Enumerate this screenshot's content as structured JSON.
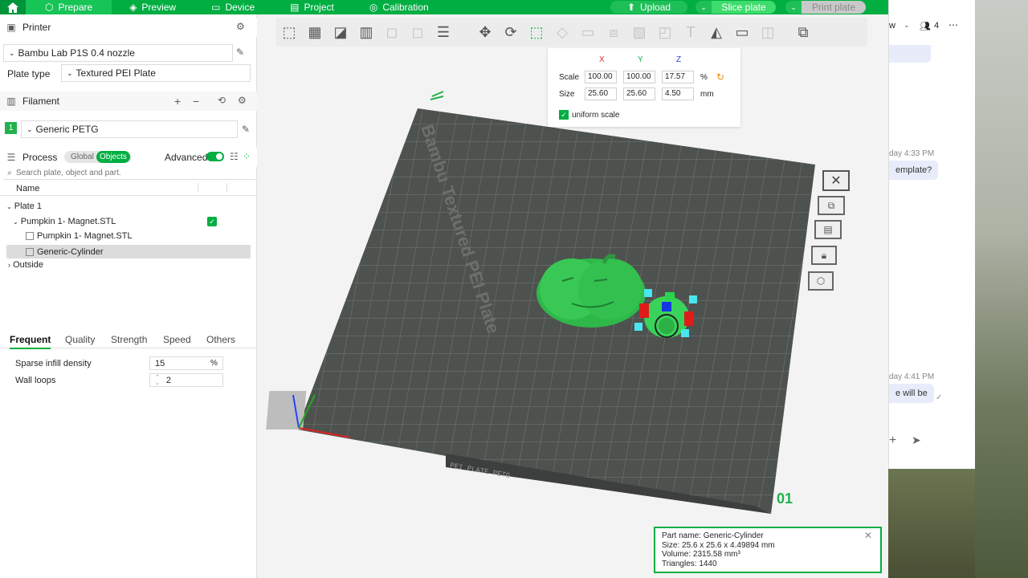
{
  "topbar": {
    "tabs": [
      {
        "label": "Prepare",
        "icon": "cube-icon"
      },
      {
        "label": "Preview",
        "icon": "layers-icon"
      },
      {
        "label": "Device",
        "icon": "monitor-icon"
      },
      {
        "label": "Project",
        "icon": "document-icon"
      },
      {
        "label": "Calibration",
        "icon": "gauge-icon"
      }
    ],
    "upload_label": "Upload",
    "slice_label": "Slice plate",
    "print_label": "Print plate",
    "accent": "#00ae42"
  },
  "printer": {
    "section_title": "Printer",
    "printer_name": "Bambu Lab P1S 0.4 nozzle",
    "plate_type_label": "Plate type",
    "plate_type_value": "Textured PEI Plate"
  },
  "filament": {
    "section_title": "Filament",
    "slot_number": "1",
    "slot_name": "Generic PETG",
    "slot_color": "#22b14c"
  },
  "process": {
    "section_title": "Process",
    "toggle_global": "Global",
    "toggle_objects": "Objects",
    "advanced_label": "Advanced",
    "search_placeholder": "Search plate, object and part.",
    "column_name": "Name"
  },
  "tree": {
    "plate": "Plate 1",
    "object": "Pumpkin 1- Magnet.STL",
    "parts": [
      "Pumpkin 1- Magnet.STL",
      "Generic-Cylinder"
    ],
    "outside": "Outside"
  },
  "settings_tabs": [
    "Frequent",
    "Quality",
    "Strength",
    "Speed",
    "Others"
  ],
  "settings": {
    "infill_label": "Sparse infill density",
    "infill_value": "15",
    "infill_unit": "%",
    "wall_label": "Wall loops",
    "wall_value": "2"
  },
  "scale_panel": {
    "col_x": "X",
    "col_y": "Y",
    "col_z": "Z",
    "scale_label": "Scale",
    "scale_x": "100.00",
    "scale_y": "100.00",
    "scale_z": "17.57",
    "scale_unit": "%",
    "size_label": "Size",
    "size_x": "25.60",
    "size_y": "25.60",
    "size_z": "4.50",
    "size_unit": "mm",
    "uniform_label": "uniform scale"
  },
  "viewport": {
    "plate_text": "Bambu Textured PEI Plate",
    "plate_number": "01",
    "bed_label": "PEI PLATE PETG"
  },
  "part_info": {
    "name": "Part name: Generic-Cylinder",
    "size": "Size: 25.6 x 25.6 x 4.49894 mm",
    "volume": "Volume: 2315.58 mm³",
    "triangles": "Triangles: 1440"
  },
  "chat": {
    "header_fragment": "w",
    "member_count": "4",
    "time_1": "day 4:33 PM",
    "message_1": "emplate?",
    "time_2": "day 4:41 PM",
    "message_2": "e will be"
  }
}
